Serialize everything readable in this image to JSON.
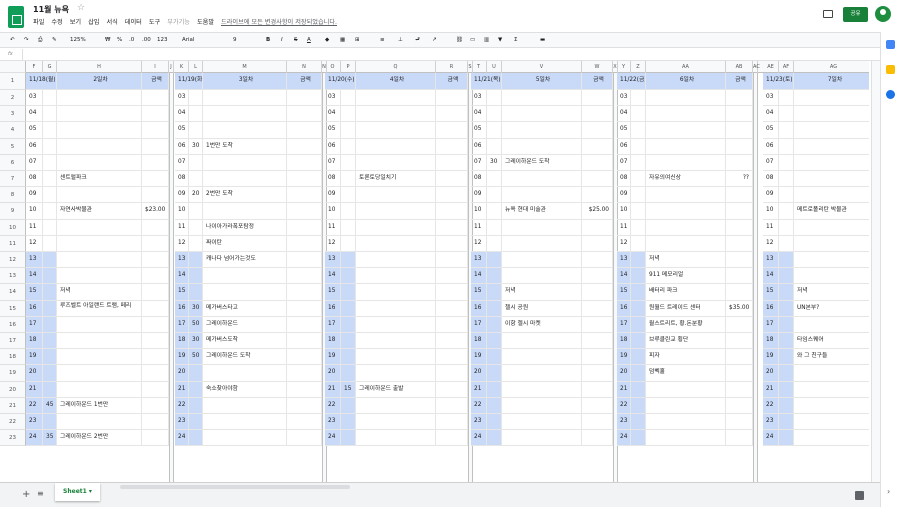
{
  "title": "11월 뉴욕",
  "menu": [
    "파일",
    "수정",
    "보기",
    "삽입",
    "서식",
    "데이터",
    "도구"
  ],
  "menu_muted": "부가기능",
  "menu_help": "도움말",
  "save_status": "드라이브에 모든 변경사항이 저장되었습니다.",
  "share_label": "공유",
  "toolbar": {
    "zoom": "125%",
    "currency": "₩",
    "percent": "%",
    "dec_minus": ".0",
    "dec_plus": ".00",
    "format": "123",
    "font": "Arial",
    "size": "9",
    "bold": "B",
    "italic": "I",
    "strike": "S",
    "textcolor": "A"
  },
  "fx": "fx",
  "sheet_tab": "Sheet1",
  "days": [
    {
      "cols": [
        "F",
        "G",
        "H",
        "I",
        "J"
      ],
      "date": "11/18(월)",
      "day": "2일차",
      "amount_hdr": "금액",
      "rows": {
        "2": [
          "03",
          "",
          ""
        ],
        "3": [
          "04",
          "",
          ""
        ],
        "4": [
          "05",
          "",
          ""
        ],
        "5": [
          "06",
          "",
          ""
        ],
        "6": [
          "07",
          "",
          ""
        ],
        "7": [
          "08",
          "",
          "센트럴파크"
        ],
        "8": [
          "09",
          "",
          ""
        ],
        "9": [
          "10",
          "",
          "자연사박물관",
          "$23.00"
        ],
        "10": [
          "11",
          "",
          ""
        ],
        "11": [
          "12",
          "",
          ""
        ],
        "12": [
          "13",
          "",
          ""
        ],
        "13": [
          "14",
          "",
          ""
        ],
        "14": [
          "15",
          "",
          "저녁"
        ],
        "15": [
          "16",
          "",
          "루즈벨트 아일랜드 트램, 페리"
        ],
        "16": [
          "17",
          "",
          ""
        ],
        "17": [
          "18",
          "",
          ""
        ],
        "18": [
          "19",
          "",
          ""
        ],
        "19": [
          "20",
          "",
          ""
        ],
        "20": [
          "21",
          "",
          ""
        ],
        "21": [
          "22",
          "45",
          "그레이하운드 1번만"
        ],
        "22": [
          "23",
          "",
          ""
        ],
        "23": [
          "24",
          "35",
          "그레이하운드 2번만"
        ]
      }
    },
    {
      "cols": [
        "K",
        "L",
        "M",
        "N"
      ],
      "date": "11/19(화)",
      "day": "3일차",
      "amount_hdr": "금액",
      "rows": {
        "2": [
          "03",
          "",
          ""
        ],
        "3": [
          "04",
          "",
          ""
        ],
        "4": [
          "05",
          "",
          ""
        ],
        "5": [
          "06",
          "30",
          "1번만 도착"
        ],
        "6": [
          "07",
          "",
          ""
        ],
        "7": [
          "08",
          "",
          ""
        ],
        "8": [
          "09",
          "20",
          "2번만 도착"
        ],
        "9": [
          "10",
          "",
          ""
        ],
        "10": [
          "11",
          "",
          "나이아가라폭포탐정"
        ],
        "11": [
          "12",
          "",
          "짜이탄"
        ],
        "12": [
          "13",
          "",
          "캐나다 넘어가는것도"
        ],
        "13": [
          "14",
          "",
          ""
        ],
        "14": [
          "15",
          "",
          ""
        ],
        "15": [
          "16",
          "30",
          "메가버스타고"
        ],
        "16": [
          "17",
          "50",
          "그레이하운드"
        ],
        "17": [
          "18",
          "30",
          "메가버스도착"
        ],
        "18": [
          "19",
          "50",
          "그레이하운드 도착"
        ],
        "19": [
          "20",
          "",
          ""
        ],
        "20": [
          "21",
          "",
          "숙소찾아야함"
        ],
        "21": [
          "22",
          "",
          ""
        ],
        "22": [
          "23",
          "",
          ""
        ],
        "23": [
          "24",
          "",
          ""
        ]
      }
    },
    {
      "cols": [
        "O",
        "P",
        "Q",
        "R",
        "S"
      ],
      "date": "11/20(수)",
      "day": "4일차",
      "amount_hdr": "금액",
      "rows": {
        "2": [
          "03",
          "",
          ""
        ],
        "3": [
          "04",
          "",
          ""
        ],
        "4": [
          "05",
          "",
          ""
        ],
        "5": [
          "06",
          "",
          ""
        ],
        "6": [
          "07",
          "",
          ""
        ],
        "7": [
          "08",
          "",
          "토론토당일치기"
        ],
        "8": [
          "09",
          "",
          ""
        ],
        "9": [
          "10",
          "",
          ""
        ],
        "10": [
          "11",
          "",
          ""
        ],
        "11": [
          "12",
          "",
          ""
        ],
        "12": [
          "13",
          "",
          ""
        ],
        "13": [
          "14",
          "",
          ""
        ],
        "14": [
          "15",
          "",
          ""
        ],
        "15": [
          "16",
          "",
          ""
        ],
        "16": [
          "17",
          "",
          ""
        ],
        "17": [
          "18",
          "",
          ""
        ],
        "18": [
          "19",
          "",
          ""
        ],
        "19": [
          "20",
          "",
          ""
        ],
        "20": [
          "21",
          "15",
          "그레이하운드 출발"
        ],
        "21": [
          "22",
          "",
          ""
        ],
        "22": [
          "23",
          "",
          ""
        ],
        "23": [
          "24",
          "",
          ""
        ]
      }
    },
    {
      "cols": [
        "T",
        "U",
        "V",
        "W",
        "X"
      ],
      "date": "11/21(목)",
      "day": "5일차",
      "amount_hdr": "금액",
      "rows": {
        "2": [
          "03",
          "",
          ""
        ],
        "3": [
          "04",
          "",
          ""
        ],
        "4": [
          "05",
          "",
          ""
        ],
        "5": [
          "06",
          "",
          ""
        ],
        "6": [
          "07",
          "30",
          "그레이하운드 도착"
        ],
        "7": [
          "08",
          "",
          ""
        ],
        "8": [
          "09",
          "",
          ""
        ],
        "9": [
          "10",
          "",
          "뉴욕 현대 미술관",
          "$25.00"
        ],
        "10": [
          "11",
          "",
          ""
        ],
        "11": [
          "12",
          "",
          ""
        ],
        "12": [
          "13",
          "",
          ""
        ],
        "13": [
          "14",
          "",
          ""
        ],
        "14": [
          "15",
          "",
          "저녁"
        ],
        "15": [
          "16",
          "",
          "첼시 공원"
        ],
        "16": [
          "17",
          "",
          "이항 첼시 마켓"
        ],
        "17": [
          "18",
          "",
          ""
        ],
        "18": [
          "19",
          "",
          ""
        ],
        "19": [
          "20",
          "",
          ""
        ],
        "20": [
          "21",
          "",
          ""
        ],
        "21": [
          "22",
          "",
          ""
        ],
        "22": [
          "23",
          "",
          ""
        ],
        "23": [
          "24",
          "",
          ""
        ]
      }
    },
    {
      "cols": [
        "Y",
        "Z",
        "AA",
        "AB",
        "AC"
      ],
      "date": "11/22(금)",
      "day": "6일차",
      "amount_hdr": "금액",
      "rows": {
        "2": [
          "03",
          "",
          ""
        ],
        "3": [
          "04",
          "",
          ""
        ],
        "4": [
          "05",
          "",
          ""
        ],
        "5": [
          "06",
          "",
          ""
        ],
        "6": [
          "07",
          "",
          ""
        ],
        "7": [
          "08",
          "",
          "자유의여신상",
          "??"
        ],
        "8": [
          "09",
          "",
          ""
        ],
        "9": [
          "10",
          "",
          ""
        ],
        "10": [
          "11",
          "",
          ""
        ],
        "11": [
          "12",
          "",
          ""
        ],
        "12": [
          "13",
          "",
          "저녁"
        ],
        "13": [
          "14",
          "",
          "911 메모리얼"
        ],
        "14": [
          "15",
          "",
          "배터리 파크"
        ],
        "15": [
          "16",
          "",
          "원월드 트레이드 센터",
          "$35.00"
        ],
        "16": [
          "17",
          "",
          "월스트리트, 황.돈분황"
        ],
        "17": [
          "18",
          "",
          "브루클린교 횡단"
        ],
        "18": [
          "19",
          "",
          "피자"
        ],
        "19": [
          "20",
          "",
          "덤벡홀"
        ],
        "20": [
          "21",
          "",
          ""
        ],
        "21": [
          "22",
          "",
          ""
        ],
        "22": [
          "23",
          "",
          ""
        ],
        "23": [
          "24",
          "",
          ""
        ]
      }
    },
    {
      "cols": [
        "AD",
        "AE",
        "AF",
        "AG"
      ],
      "date": "11/23(토)",
      "day": "7일차",
      "amount_hdr": "",
      "rows": {
        "2": [
          "03",
          "",
          ""
        ],
        "3": [
          "04",
          "",
          ""
        ],
        "4": [
          "05",
          "",
          ""
        ],
        "5": [
          "06",
          "",
          ""
        ],
        "6": [
          "07",
          "",
          ""
        ],
        "7": [
          "08",
          "",
          ""
        ],
        "8": [
          "09",
          "",
          ""
        ],
        "9": [
          "10",
          "",
          "메트로폴리탄 박물관"
        ],
        "10": [
          "11",
          "",
          ""
        ],
        "11": [
          "12",
          "",
          ""
        ],
        "12": [
          "13",
          "",
          ""
        ],
        "13": [
          "14",
          "",
          ""
        ],
        "14": [
          "15",
          "",
          "저녁"
        ],
        "15": [
          "16",
          "",
          "UN본부?"
        ],
        "16": [
          "17",
          "",
          ""
        ],
        "17": [
          "18",
          "",
          "타임스퀘어"
        ],
        "18": [
          "19",
          "",
          "와 그 친구들"
        ],
        "19": [
          "20",
          "",
          ""
        ],
        "20": [
          "21",
          "",
          ""
        ],
        "21": [
          "22",
          "",
          ""
        ],
        "22": [
          "23",
          "",
          ""
        ],
        "23": [
          "24",
          "",
          ""
        ]
      }
    }
  ]
}
